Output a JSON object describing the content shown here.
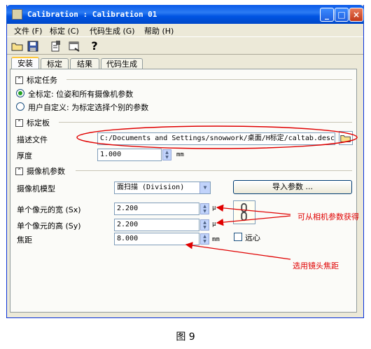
{
  "window": {
    "title": "Calibration : Calibration 01",
    "controls": [
      "_",
      "□",
      "×"
    ]
  },
  "menu": [
    {
      "label": "文件 (F)"
    },
    {
      "label": "标定 (C)"
    },
    {
      "label": "代码生成 (G)"
    },
    {
      "label": "帮助 (H)"
    }
  ],
  "toolbar": {
    "icons": [
      "open-folder-icon",
      "save-icon",
      "export-icon",
      "window-icon",
      "help-icon"
    ],
    "help_glyph": "?"
  },
  "tabs": [
    {
      "label": "安装",
      "active": true
    },
    {
      "label": "标定"
    },
    {
      "label": "结果"
    },
    {
      "label": "代码生成"
    }
  ],
  "calibration_task": {
    "title": "标定任务",
    "options": [
      {
        "label": "全标定: 位姿和所有摄像机参数",
        "checked": true
      },
      {
        "label": "用户自定义: 为标定选择个别的参数",
        "checked": false
      }
    ]
  },
  "calibration_plate": {
    "title": "标定板",
    "description_label": "描述文件",
    "description_value": "C:/Documents and Settings/snowwork/桌面/H标定/caltab.descr",
    "thickness_label": "厚度",
    "thickness_value": "1.000",
    "thickness_unit": "mm"
  },
  "camera_params": {
    "title": "摄像机参数",
    "model_label": "摄像机模型",
    "model_value": "面扫描 (Division)",
    "import_button": "导入参数 ...",
    "sx_label": "单个像元的宽 (Sx)",
    "sx_value": "2.200",
    "sx_unit": "μ",
    "sy_label": "单个像元的高 (Sy)",
    "sy_value": "2.200",
    "sy_unit": "μ",
    "focal_label": "焦距",
    "focal_value": "8.000",
    "focal_unit": "mm",
    "telecentric_label": "远心",
    "telecentric_checked": false
  },
  "annotations": {
    "from_camera": "可从相机参数获得",
    "choose_lens": "选用镜头焦距"
  },
  "caption": "图 9",
  "colors": {
    "annotation": "#e00000",
    "titlebar": "#0054e3",
    "window_bg": "#ece9d8"
  }
}
